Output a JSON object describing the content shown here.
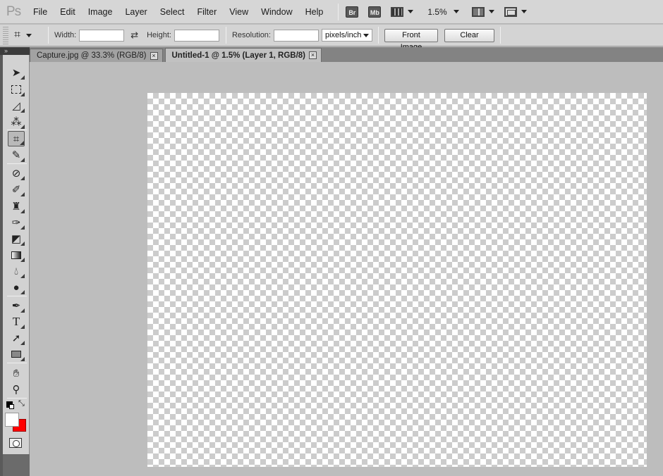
{
  "app": {
    "logo": "Ps"
  },
  "menu": [
    "File",
    "Edit",
    "Image",
    "Layer",
    "Select",
    "Filter",
    "View",
    "Window",
    "Help"
  ],
  "app_bar": {
    "bridge": "Br",
    "mini_bridge": "Mb",
    "zoom": "1.5%"
  },
  "options": {
    "width_label": "Width:",
    "width_value": "",
    "height_label": "Height:",
    "height_value": "",
    "resolution_label": "Resolution:",
    "resolution_value": "",
    "units": "pixels/inch",
    "front_image": "Front Image",
    "clear": "Clear"
  },
  "tabs": [
    {
      "label": "Capture.jpg @ 33.3% (RGB/8)",
      "active": false
    },
    {
      "label": "Untitled-1 @ 1.5% (Layer 1, RGB/8)",
      "active": true
    }
  ],
  "toolbox": {
    "collapse": "»",
    "tools": [
      "move-tool",
      "marquee-tool",
      "lasso-tool",
      "quick-selection-tool",
      "crop-tool",
      "eyedropper-tool",
      "healing-brush-tool",
      "brush-tool",
      "clone-stamp-tool",
      "history-brush-tool",
      "eraser-tool",
      "gradient-tool",
      "blur-tool",
      "dodge-tool",
      "pen-tool",
      "type-tool",
      "path-selection-tool",
      "rectangle-tool",
      "hand-tool",
      "zoom-tool"
    ],
    "selected": "crop-tool",
    "type_glyph": "T",
    "foreground": "#ffffff",
    "background": "#ff0000"
  },
  "colors": {
    "canvas_check_dark": "#cccccc",
    "canvas_check_light": "#ffffff",
    "workspace": "#bdbdbd"
  }
}
